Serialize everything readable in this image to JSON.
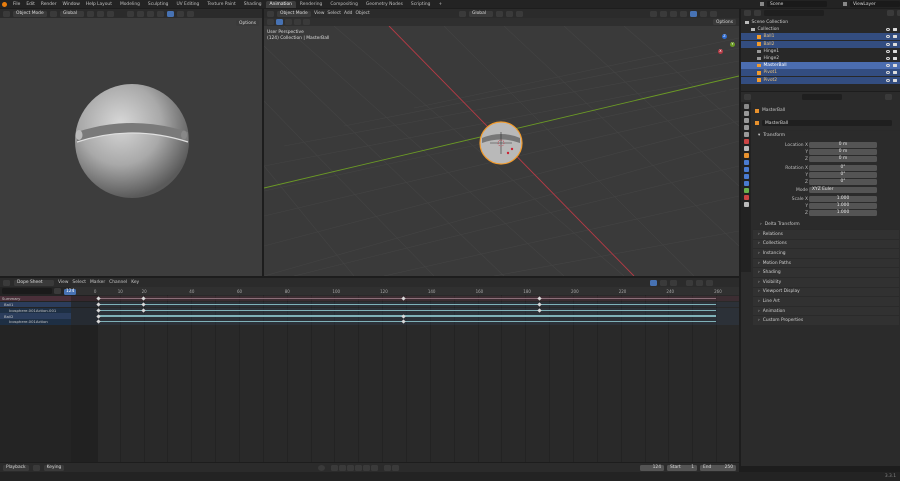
{
  "topbar": {
    "menus": [
      "File",
      "Edit",
      "Render",
      "Window",
      "Help"
    ],
    "workspaces": [
      "Layout",
      "Modeling",
      "Sculpting",
      "UV Editing",
      "Texture Paint",
      "Shading",
      "Animation",
      "Rendering",
      "Compositing",
      "Geometry Nodes",
      "Scripting"
    ],
    "active_workspace": "Animation",
    "add_tab": "+",
    "scene_label": "Scene",
    "viewlayer_label": "ViewLayer"
  },
  "left_viewport": {
    "mode": "Object Mode",
    "orientation": "Global",
    "options": "Options"
  },
  "main_viewport": {
    "mode": "Object Mode",
    "menus": [
      "View",
      "Select",
      "Add",
      "Object"
    ],
    "orientation": "Global",
    "options": "Options",
    "overlay_line1": "User Perspective",
    "overlay_line2": "(124) Collection | MasterBall",
    "gizmo": {
      "z": "Z",
      "y": "Y",
      "x": "X"
    }
  },
  "outliner": {
    "search_placeholder": "",
    "items": [
      {
        "name": "Scene Collection",
        "indent": 0,
        "selected": false
      },
      {
        "name": "Collection",
        "indent": 1,
        "selected": false
      },
      {
        "name": "Ball1",
        "indent": 2,
        "selected": true
      },
      {
        "name": "Ball2",
        "indent": 2,
        "selected": true
      },
      {
        "name": "Hinge1",
        "indent": 2,
        "selected": false
      },
      {
        "name": "Hinge2",
        "indent": 2,
        "selected": false
      },
      {
        "name": "MasterBall",
        "indent": 2,
        "selected": true,
        "active": true
      },
      {
        "name": "Pivot1",
        "indent": 2,
        "selected": true
      },
      {
        "name": "Pivot2",
        "indent": 2,
        "selected": true
      }
    ]
  },
  "properties": {
    "object_name": "MasterBall",
    "object_field": "MasterBall",
    "transform_title": "Transform",
    "location": {
      "label_x": "Location X",
      "label_y": "Y",
      "label_z": "Z",
      "x": "0 m",
      "y": "0 m",
      "z": "0 m"
    },
    "rotation": {
      "label_x": "Rotation X",
      "label_y": "Y",
      "label_z": "Z",
      "x": "0°",
      "y": "0°",
      "z": "0°"
    },
    "mode_label": "Mode",
    "mode_value": "XYZ Euler",
    "scale": {
      "label_x": "Scale X",
      "label_y": "Y",
      "label_z": "Z",
      "x": "1.000",
      "y": "1.000",
      "z": "1.000"
    },
    "delta_transform": "Delta Transform",
    "panels": [
      "Relations",
      "Collections",
      "Instancing",
      "Motion Paths",
      "Shading",
      "Visibility",
      "Viewport Display",
      "Line Art",
      "Animation",
      "Custom Properties"
    ]
  },
  "dopesheet": {
    "editor": "Dope Sheet",
    "menus": [
      "View",
      "Select",
      "Marker",
      "Channel",
      "Key"
    ],
    "current_frame_badge": "124",
    "ticks": [
      "0",
      "10",
      "20",
      "40",
      "60",
      "80",
      "100",
      "120",
      "140",
      "160",
      "180",
      "200",
      "220",
      "240",
      "260"
    ],
    "channels": [
      {
        "name": "Summary",
        "kind": "summary"
      },
      {
        "name": "Ball1",
        "kind": "object"
      },
      {
        "name": "Icosphere.001Action.001",
        "kind": "action"
      },
      {
        "name": "Ball2",
        "kind": "object"
      },
      {
        "name": "Icosphere.001Action",
        "kind": "action"
      }
    ]
  },
  "timeline": {
    "playback": "Playback",
    "keying": "Keying",
    "current_frame": "124",
    "start_label": "Start",
    "start_value": "1",
    "end_label": "End",
    "end_value": "250"
  },
  "statusbar": {
    "version": "3.3.1"
  },
  "colors": {
    "accent": "#4772b3",
    "selection_orange": "#f29b2c",
    "x_axis": "#b53a45",
    "y_axis": "#6b9a25"
  }
}
